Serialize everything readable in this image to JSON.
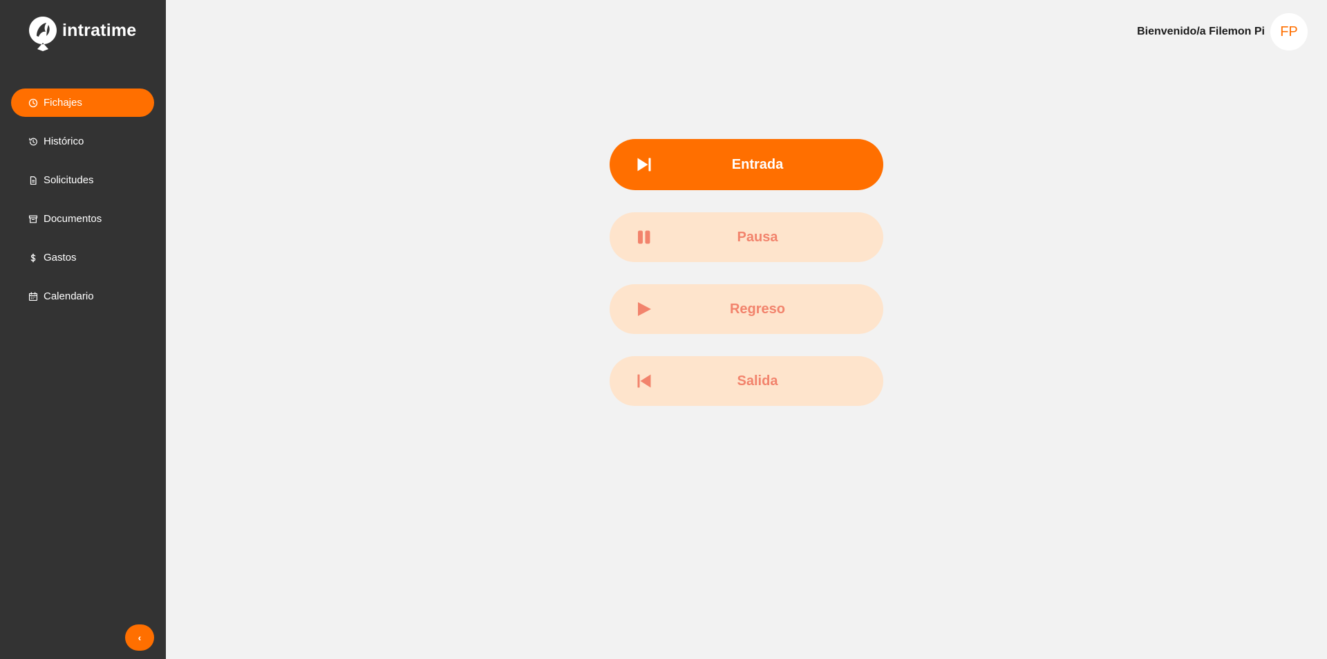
{
  "app": {
    "logo_text": "intratime"
  },
  "sidebar": {
    "items": [
      {
        "label": "Fichajes",
        "icon": "clock-icon",
        "active": true
      },
      {
        "label": "Histórico",
        "icon": "history-icon",
        "active": false
      },
      {
        "label": "Solicitudes",
        "icon": "document-icon",
        "active": false
      },
      {
        "label": "Documentos",
        "icon": "archive-icon",
        "active": false
      },
      {
        "label": "Gastos",
        "icon": "dollar-icon",
        "active": false
      },
      {
        "label": "Calendario",
        "icon": "calendar-icon",
        "active": false
      }
    ],
    "collapse_label": "‹"
  },
  "header": {
    "welcome": "Bienvenido/a Filemon Pi",
    "avatar_initials": "FP"
  },
  "actions": [
    {
      "label": "Entrada",
      "icon": "skip-forward-icon",
      "state": "enabled"
    },
    {
      "label": "Pausa",
      "icon": "pause-icon",
      "state": "disabled"
    },
    {
      "label": "Regreso",
      "icon": "play-icon",
      "state": "disabled"
    },
    {
      "label": "Salida",
      "icon": "skip-back-icon",
      "state": "disabled"
    }
  ],
  "colors": {
    "accent": "#ff6f00",
    "sidebar_bg": "#333333",
    "page_bg": "#f2f2f2",
    "disabled_bg": "#fee4cc",
    "disabled_text": "#f2836c"
  }
}
